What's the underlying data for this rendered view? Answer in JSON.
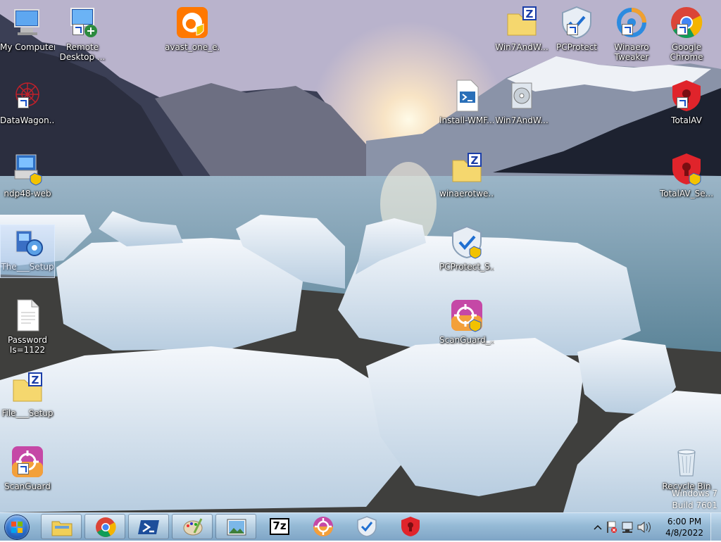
{
  "desktop": {
    "icons": [
      {
        "label": "My Computer",
        "icon": "computer-icon"
      },
      {
        "label": "Remote Desktop ...",
        "icon": "remote-desktop-icon"
      },
      {
        "label": "avast_one_e...",
        "icon": "avast-icon"
      },
      {
        "label": "Win7AndW...",
        "icon": "zip-folder-icon"
      },
      {
        "label": "PCProtect",
        "icon": "pcprotect-shield-icon"
      },
      {
        "label": "Winaero Tweaker",
        "icon": "winaero-tweaker-icon"
      },
      {
        "label": "Google Chrome",
        "icon": "chrome-icon"
      },
      {
        "label": "DataWagon...",
        "icon": "datawagon-icon"
      },
      {
        "label": "Install-WMF...",
        "icon": "powershell-script-icon"
      },
      {
        "label": "Win7AndW...",
        "icon": "installer-disc-icon"
      },
      {
        "label": "TotalAV",
        "icon": "totalav-icon"
      },
      {
        "label": "ndp48-web",
        "icon": "dotnet-installer-icon"
      },
      {
        "label": "winaerotwe...",
        "icon": "zip-folder-icon"
      },
      {
        "label": "TotalAV_Se...",
        "icon": "totalav-setup-icon"
      },
      {
        "label": "The___Setup",
        "icon": "setup-icon"
      },
      {
        "label": "PCProtect_S...",
        "icon": "pcprotect-setup-icon"
      },
      {
        "label": "Password Is=1122",
        "icon": "text-file-icon"
      },
      {
        "label": "ScanGuard_...",
        "icon": "scanguard-setup-icon"
      },
      {
        "label": "File___Setup",
        "icon": "zip-folder-icon"
      },
      {
        "label": "ScanGuard",
        "icon": "scanguard-icon"
      },
      {
        "label": "Recycle Bin",
        "icon": "recycle-bin-icon"
      }
    ],
    "watermark": {
      "line1": "Windows 7",
      "line2": "Build 7601"
    }
  },
  "taskbar": {
    "items": [
      {
        "icon": "start-orb-icon"
      },
      {
        "icon": "file-explorer-icon"
      },
      {
        "icon": "chrome-icon"
      },
      {
        "icon": "powershell-icon"
      },
      {
        "icon": "paint-icon"
      },
      {
        "icon": "photo-viewer-icon"
      },
      {
        "icon": "7zip-icon",
        "text": "7z"
      },
      {
        "icon": "scanguard-icon"
      },
      {
        "icon": "pcprotect-icon"
      },
      {
        "icon": "totalav-icon"
      }
    ],
    "tray": {
      "icons": [
        "show-hidden-icons-chevron",
        "action-center-flag-icon",
        "network-icon",
        "volume-icon"
      ],
      "time": "6:00 PM",
      "date": "4/8/2022"
    }
  }
}
